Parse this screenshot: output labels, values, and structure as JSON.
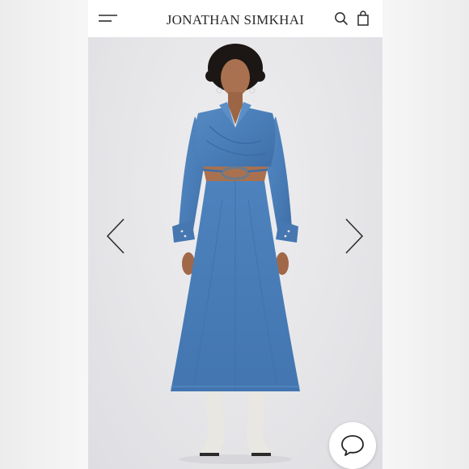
{
  "header": {
    "brand": "JONATHAN SIMKHAI",
    "icons": {
      "menu": "hamburger-menu-icon",
      "search": "search-icon",
      "bag": "shopping-bag-icon"
    }
  },
  "gallery": {
    "image": "denim-cutout-midi-dress-model-photo",
    "prev_icon": "chevron-left-icon",
    "next_icon": "chevron-right-icon"
  },
  "chat": {
    "icon": "chat-bubble-icon"
  },
  "colors": {
    "header_bg": "#ffffff",
    "hero_bg": "#e7e7e9",
    "denim": "#4a7eb8",
    "text": "#2a2a2a"
  }
}
